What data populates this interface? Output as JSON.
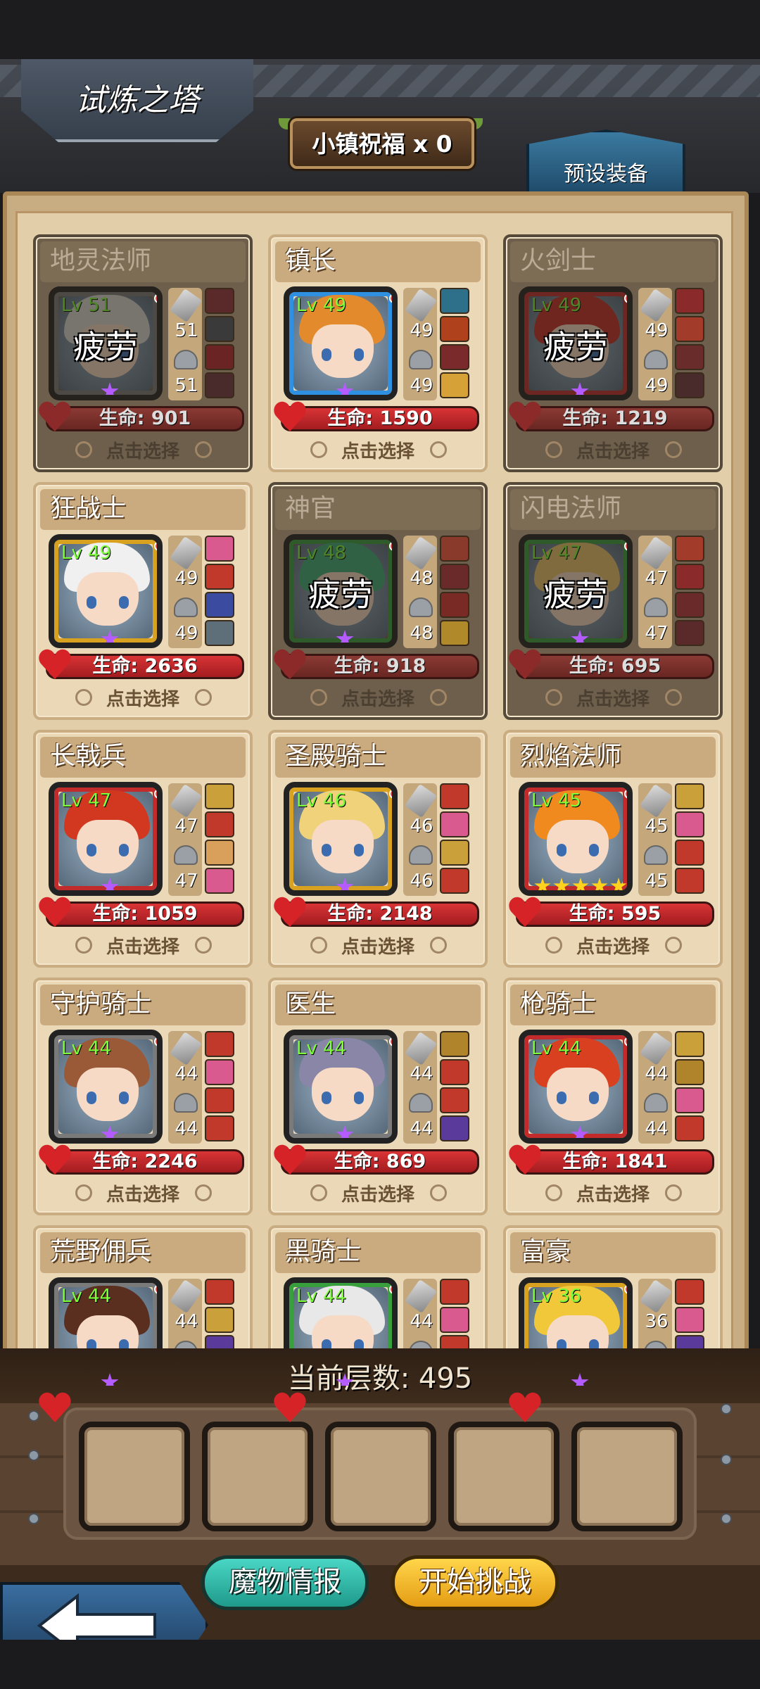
{
  "header": {
    "title": "试炼之塔",
    "blessing": "小镇祝福 x 0",
    "preset_button": "预设装备"
  },
  "labels": {
    "tired": "疲劳",
    "select": "点击选择"
  },
  "heroes": [
    {
      "name": "地灵法师",
      "lv_text": "Lv 51",
      "weapon": "51",
      "armor": "51",
      "hp": "生命: 901",
      "tired": true,
      "frame": "c-gray",
      "hair": "#d8dad2",
      "items": [
        "#5a2a2a",
        "#3a3a3a",
        "#6a2424",
        "#4a2b2b"
      ]
    },
    {
      "name": "镇长",
      "lv_text": "Lv 49",
      "weapon": "49",
      "armor": "49",
      "hp": "生命: 1590",
      "tired": false,
      "frame": "c-blue",
      "hair": "#e38a2c",
      "items": [
        "#2e6f8a",
        "#b0411d",
        "#7a2a2a",
        "#d6a137"
      ]
    },
    {
      "name": "火剑士",
      "lv_text": "Lv 49",
      "weapon": "49",
      "armor": "49",
      "hp": "生命: 1219",
      "tired": true,
      "frame": "c-red",
      "hair": "#c62b25",
      "items": [
        "#8a2a2a",
        "#a33b2a",
        "#6a2b2b",
        "#4a2b2b"
      ]
    },
    {
      "name": "狂战士",
      "lv_text": "Lv 49",
      "weapon": "49",
      "armor": "49",
      "hp": "生命: 2636",
      "tired": false,
      "frame": "c-gold",
      "hair": "#f0f0f0",
      "items": [
        "#d85a8f",
        "#c0392b",
        "#3a4ba0",
        "#5f6f7a"
      ]
    },
    {
      "name": "神官",
      "lv_text": "Lv 48",
      "weapon": "48",
      "armor": "48",
      "hp": "生命: 918",
      "tired": true,
      "frame": "c-green",
      "hair": "#3cae7a",
      "items": [
        "#8a3a2a",
        "#6a2a2a",
        "#7a2a24",
        "#b08a2a"
      ]
    },
    {
      "name": "闪电法师",
      "lv_text": "Lv 47",
      "weapon": "47",
      "armor": "47",
      "hp": "生命: 695",
      "tired": true,
      "frame": "c-green",
      "hair": "#e8c36a",
      "items": [
        "#a33b2a",
        "#8a2a2a",
        "#6a2a2a",
        "#5a2a2a"
      ]
    },
    {
      "name": "长戟兵",
      "lv_text": "Lv 47",
      "weapon": "47",
      "armor": "47",
      "hp": "生命: 1059",
      "tired": false,
      "frame": "c-red",
      "hair": "#d1381f",
      "items": [
        "#caa03a",
        "#c0392b",
        "#d8a05a",
        "#d85a8f"
      ]
    },
    {
      "name": "圣殿骑士",
      "lv_text": "Lv 46",
      "weapon": "46",
      "armor": "46",
      "hp": "生命: 2148",
      "tired": false,
      "frame": "c-gold",
      "hair": "#efd27a",
      "items": [
        "#c0392b",
        "#d85a8f",
        "#caa03a",
        "#c0392b"
      ]
    },
    {
      "name": "烈焰法师",
      "lv_text": "Lv 45",
      "weapon": "45",
      "armor": "45",
      "hp": "生命: 595",
      "tired": false,
      "frame": "c-red",
      "hair": "#f08a1e",
      "items": [
        "#caa03a",
        "#d85a8f",
        "#c0392b",
        "#c0392b"
      ],
      "five_star": true
    },
    {
      "name": "守护骑士",
      "lv_text": "Lv 44",
      "weapon": "44",
      "armor": "44",
      "hp": "生命: 2246",
      "tired": false,
      "frame": "c-gray",
      "hair": "#9a5a38",
      "items": [
        "#c0392b",
        "#d85a8f",
        "#c0392b",
        "#c0392b"
      ]
    },
    {
      "name": "医生",
      "lv_text": "Lv 44",
      "weapon": "44",
      "armor": "44",
      "hp": "生命: 869",
      "tired": false,
      "frame": "c-gray",
      "hair": "#8a86a8",
      "items": [
        "#b0842a",
        "#c0392b",
        "#c0392b",
        "#5a3a9a"
      ]
    },
    {
      "name": "枪骑士",
      "lv_text": "Lv 44",
      "weapon": "44",
      "armor": "44",
      "hp": "生命: 1841",
      "tired": false,
      "frame": "c-red",
      "hair": "#d8401f",
      "items": [
        "#caa03a",
        "#b0842a",
        "#d85a8f",
        "#c0392b"
      ]
    },
    {
      "name": "荒野佣兵",
      "lv_text": "Lv 44",
      "weapon": "44",
      "armor": "",
      "hp": "",
      "tired": false,
      "frame": "c-gray",
      "hair": "#5a2f20",
      "items": [
        "#c0392b",
        "#caa03a",
        "#5a3a9a",
        "#c0392b"
      ]
    },
    {
      "name": "黑骑士",
      "lv_text": "Lv 44",
      "weapon": "44",
      "armor": "",
      "hp": "",
      "tired": false,
      "frame": "c-green",
      "hair": "#e8e8e8",
      "items": [
        "#c0392b",
        "#d85a8f",
        "#c0392b",
        "#c0392b"
      ]
    },
    {
      "name": "富豪",
      "lv_text": "Lv 36",
      "weapon": "36",
      "armor": "",
      "hp": "",
      "tired": false,
      "frame": "c-gold",
      "hair": "#f0c83a",
      "items": [
        "#c0392b",
        "#d85a8f",
        "#5a3a9a",
        "#c0392b"
      ]
    }
  ],
  "floor": {
    "label": "当前层数: 495"
  },
  "buttons": {
    "monster_info": "魔物情报",
    "start_challenge": "开始挑战"
  },
  "icons": {
    "back": "back-arrow-icon",
    "weapon": "sword-icon",
    "armor": "helmet-icon",
    "hp": "heart-icon",
    "rarity": "star-icon"
  }
}
